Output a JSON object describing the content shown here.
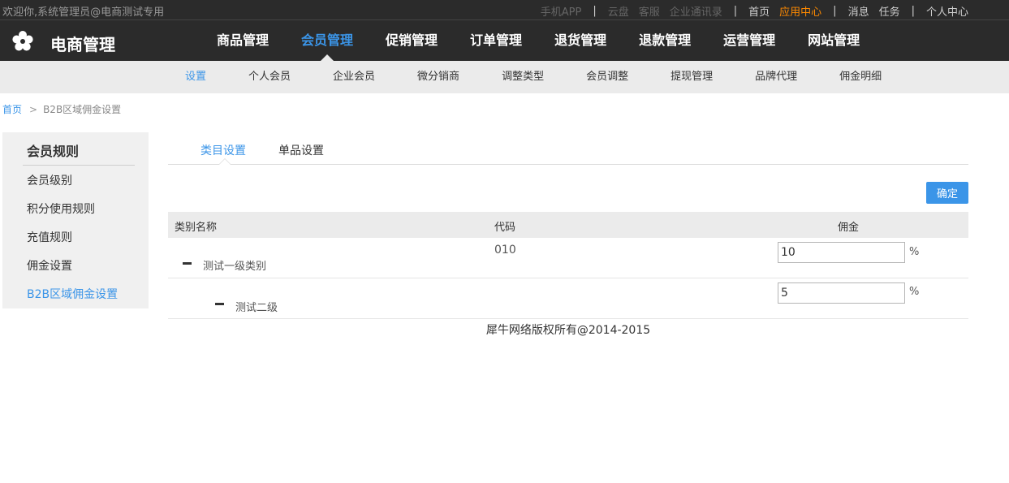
{
  "topbar": {
    "welcome": "欢迎你,系统管理员@电商测试专用",
    "links": {
      "app": "手机APP",
      "cloud": "云盘",
      "service": "客服",
      "contacts": "企业通讯录",
      "home": "首页",
      "app_center": "应用中心",
      "messages": "消息",
      "tasks": "任务",
      "personal": "个人中心"
    },
    "separator": "|"
  },
  "header": {
    "logo_icon": "flower-icon",
    "brand": "电商管理",
    "nav": [
      "商品管理",
      "会员管理",
      "促销管理",
      "订单管理",
      "退货管理",
      "退款管理",
      "运营管理",
      "网站管理"
    ],
    "active_nav": "会员管理"
  },
  "subnav": {
    "items": [
      "设置",
      "个人会员",
      "企业会员",
      "微分销商",
      "调整类型",
      "会员调整",
      "提现管理",
      "品牌代理",
      "佣金明细"
    ],
    "active": "设置"
  },
  "breadcrumb": {
    "home": "首页",
    "arrow": ">",
    "current": "B2B区域佣金设置"
  },
  "sidebar": {
    "title": "会员规则",
    "items": [
      "会员级别",
      "积分使用规则",
      "充值规则",
      "佣金设置",
      "B2B区域佣金设置"
    ],
    "active": "B2B区域佣金设置"
  },
  "tabs": {
    "items": [
      "类目设置",
      "单品设置"
    ],
    "active": "类目设置"
  },
  "confirm_label": "确定",
  "table": {
    "headers": [
      "类别名称",
      "代码",
      "佣金"
    ],
    "rows": [
      {
        "name": "测试一级类别",
        "code": "010",
        "commission": "10",
        "unit": "%"
      },
      {
        "name": "测试二级",
        "code": "",
        "commission": "5",
        "unit": "%"
      }
    ]
  },
  "footer": "犀牛网络版权所有@2014-2015",
  "colors": {
    "accent": "#3b95e8",
    "highlight": "#ff8a00",
    "topbar_bg": "#2b2b2b"
  }
}
